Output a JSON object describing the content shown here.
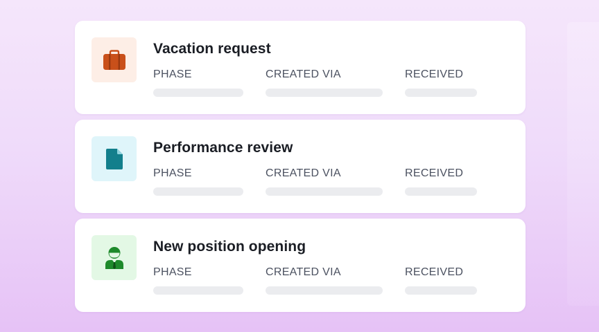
{
  "colors": {
    "background_top": "#f5e6fb",
    "background_bottom": "#e6c2f6",
    "card": "#ffffff",
    "skeleton": "#ebecef"
  },
  "cards": [
    {
      "title": "Vacation request",
      "icon": "briefcase-icon",
      "icon_color": "#c9501a",
      "tile_color": "#fdeee6",
      "fields": [
        {
          "label": "PHASE"
        },
        {
          "label": "CREATED VIA"
        },
        {
          "label": "RECEIVED"
        }
      ]
    },
    {
      "title": "Performance review",
      "icon": "document-icon",
      "icon_color": "#137f8c",
      "tile_color": "#dff5fa",
      "fields": [
        {
          "label": "PHASE"
        },
        {
          "label": "CREATED VIA"
        },
        {
          "label": "RECEIVED"
        }
      ]
    },
    {
      "title": "New position opening",
      "icon": "employee-icon",
      "icon_color": "#1e8a2b",
      "tile_color": "#e3f8e5",
      "fields": [
        {
          "label": "PHASE"
        },
        {
          "label": "CREATED VIA"
        },
        {
          "label": "RECEIVED"
        }
      ]
    }
  ]
}
